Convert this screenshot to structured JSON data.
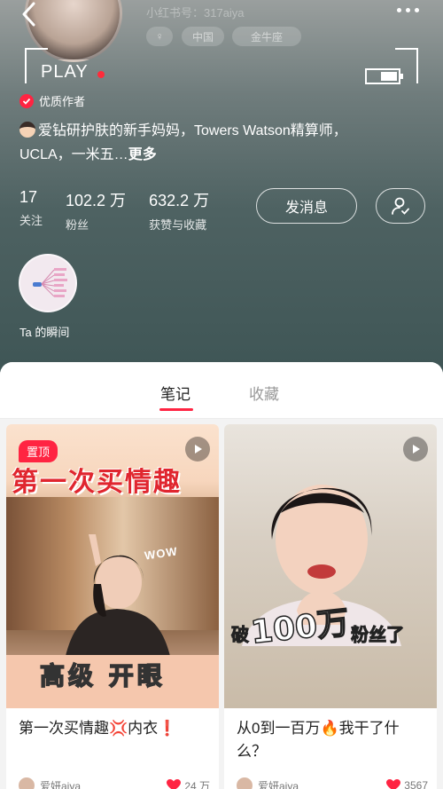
{
  "profile": {
    "redbook_id_label": "小红书号：317aiya",
    "tags": {
      "gender": "♀",
      "region": "中国",
      "sign": "金牛座"
    },
    "play_label": "PLAY",
    "badge_text": "优质作者",
    "bio_line1": "爱钻研护肤的新手妈妈，Towers Watson精算师，",
    "bio_line2": "UCLA，一米五…",
    "bio_more": "更多",
    "stats": [
      {
        "num": "17",
        "label": "关注"
      },
      {
        "num": "102.2 万",
        "label": "粉丝"
      },
      {
        "num": "632.2 万",
        "label": "获赞与收藏"
      }
    ],
    "message_button": "发消息",
    "moments_label": "Ta 的瞬间"
  },
  "tabs": {
    "notes": "笔记",
    "collect": "收藏",
    "active": "notes"
  },
  "cards": [
    {
      "pinned": "置顶",
      "cover_headline": "第一次买情趣",
      "cover_sticker": "WOW",
      "cover_caption": "高级 开眼",
      "title": "第一次买情趣💢内衣❗",
      "author": "爱妍aiya",
      "likes": "24 万"
    },
    {
      "cover_caption_pre": "破",
      "cover_caption_big": "100万",
      "cover_caption_post": "粉丝了",
      "title": "从0到一百万🔥我干了什么？",
      "author": "爱妍aiya",
      "likes": "3567"
    }
  ],
  "colors": {
    "accent": "#ff2442",
    "header_dark": "#3e5555"
  }
}
